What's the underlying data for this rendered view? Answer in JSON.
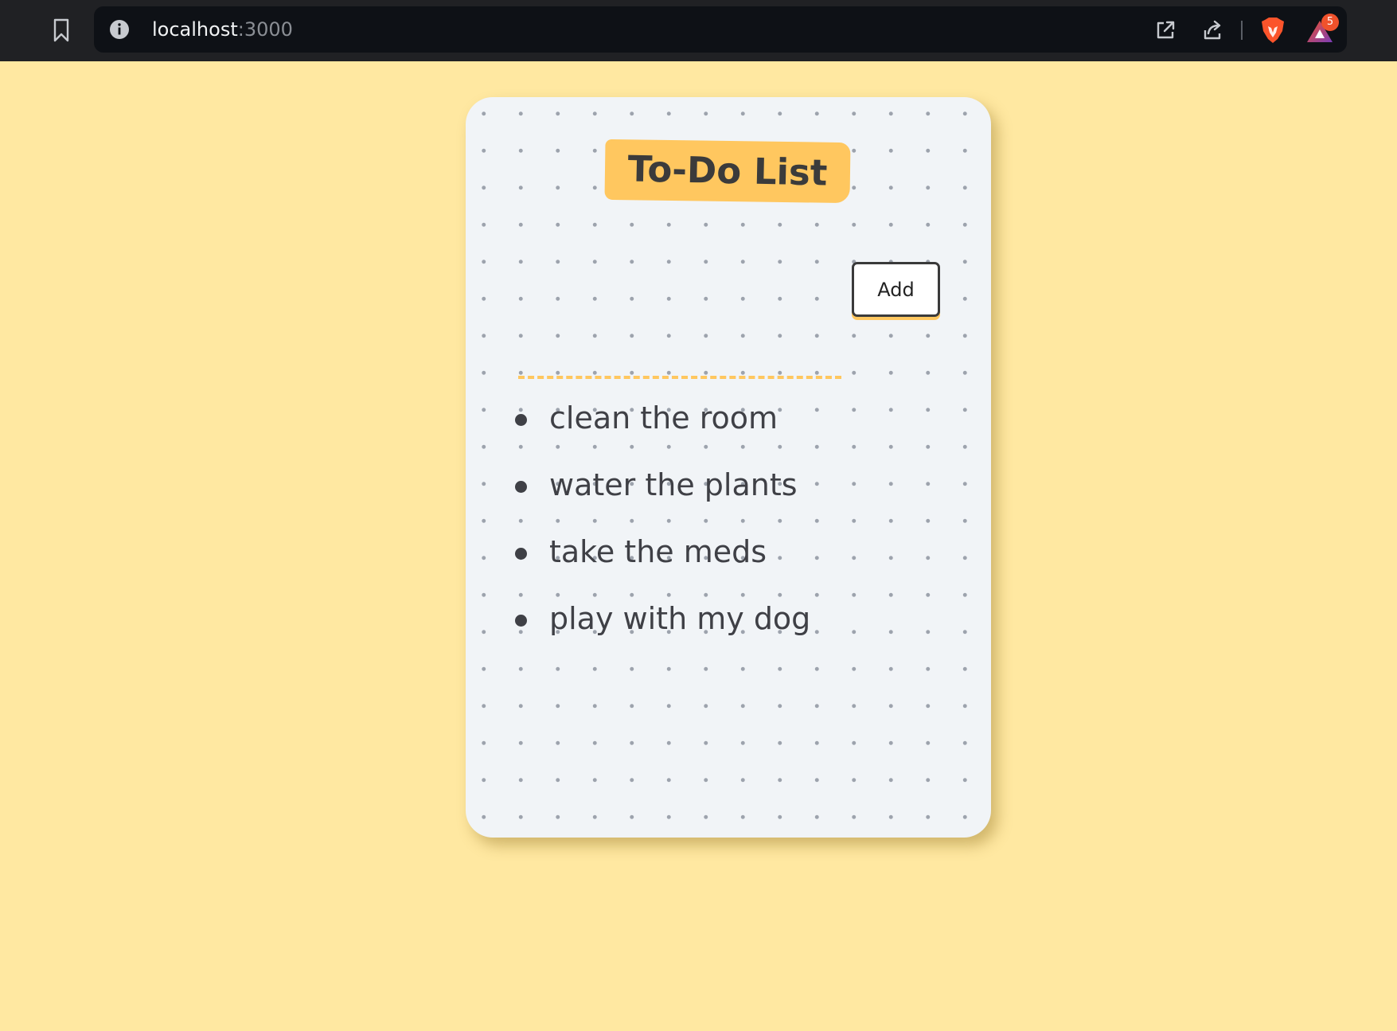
{
  "browser": {
    "url_host": "localhost",
    "url_port": ":3000",
    "notification_count": "5",
    "icons": [
      "bookmark-icon",
      "site-info-icon",
      "open-external-icon",
      "share-icon",
      "brave-lion-icon",
      "brave-rewards-icon"
    ]
  },
  "app": {
    "title": "To-Do List",
    "input": {
      "value": "",
      "placeholder": ""
    },
    "add_button_label": "Add",
    "items": [
      {
        "text": "clean the room"
      },
      {
        "text": "water the plants"
      },
      {
        "text": "take the meds"
      },
      {
        "text": "play with my dog"
      }
    ]
  },
  "colors": {
    "page_background": "#ffe8a1",
    "card_background": "#f1f4f7",
    "accent": "#ffc75f",
    "text": "#3f4046",
    "browser_bar": "#202124"
  }
}
